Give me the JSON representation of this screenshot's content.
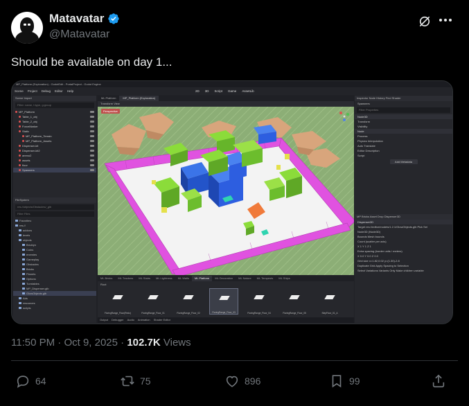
{
  "author": {
    "display_name": "Matavatar",
    "handle": "@Matavatar",
    "verified": true
  },
  "tweet": {
    "text": "Should be available on day 1...",
    "time": "11:50 PM",
    "separator": "·",
    "date": "Oct 9, 2025",
    "views_count": "102.7K",
    "views_label": "Views"
  },
  "actions": {
    "replies": "64",
    "reposts": "75",
    "likes": "896",
    "bookmarks": "99"
  },
  "editor": {
    "title": "MP_Platform (Exploration) - GodotEdit - PortalProject - Godot Engine",
    "menu": [
      "Scene",
      "Project",
      "Debug",
      "Editor",
      "Help"
    ],
    "modes": [
      "2D",
      "3D",
      "Script",
      "Game",
      "AssetLib"
    ],
    "scene_panel_tabs": "Scene   Import",
    "filter_placeholder": "Filter: name, t:type, g:group",
    "scene_tree": [
      {
        "label": "MP_Platform",
        "selected": false
      },
      {
        "label": "Table_1_obj",
        "selected": false
      },
      {
        "label": "Table_2_obj",
        "selected": false
      },
      {
        "label": "ForceMarker",
        "selected": false
      },
      {
        "label": "Static",
        "selected": false
      },
      {
        "label": "MP_Platform_Terrain",
        "selected": false
      },
      {
        "label": "MP_Platform_Assets",
        "selected": false
      },
      {
        "label": "Dispenser-kit",
        "selected": false
      },
      {
        "label": "Dispenser-kit2",
        "selected": false
      },
      {
        "label": "ammo2",
        "selected": false
      },
      {
        "label": "assets",
        "selected": false
      },
      {
        "label": "floor",
        "selected": false
      },
      {
        "label": "Spawners",
        "selected": true
      }
    ],
    "filesystem_header": "FileSystem",
    "filesystem_path": "res://objects/Obstacles/_glb",
    "filter_files": "Filter Files",
    "filesystem": [
      {
        "label": "Favorites:",
        "selected": false
      },
      {
        "label": "res://",
        "selected": false
      },
      {
        "label": "addons",
        "selected": false
      },
      {
        "label": "levels",
        "selected": false
      },
      {
        "label": "objects",
        "selected": false
      },
      {
        "label": "Bricklyn",
        "selected": false
      },
      {
        "label": "Coins",
        "selected": false
      },
      {
        "label": "enemies",
        "selected": false
      },
      {
        "label": "Gameplay",
        "selected": false
      },
      {
        "label": "Obstacles",
        "selected": false
      },
      {
        "label": "Bricks",
        "selected": false
      },
      {
        "label": "Planets",
        "selected": false
      },
      {
        "label": "Options",
        "selected": false
      },
      {
        "label": "Turntables",
        "selected": false
      },
      {
        "label": "MP_Dispenser.glb",
        "selected": false
      },
      {
        "label": "GlowObjects.glb",
        "selected": true
      },
      {
        "label": "Ads",
        "selected": false
      },
      {
        "label": "resources",
        "selected": false
      },
      {
        "label": "scripts",
        "selected": false
      }
    ],
    "scene_tabs": [
      {
        "label": "ML Platform",
        "active": false
      },
      {
        "label": "MP_Platform (Exploration)",
        "active": true
      }
    ],
    "viewport_toolbar": "Transform   View",
    "viewport_label": "Perspective",
    "bottom_tabs": [
      {
        "label": "ML Bricks",
        "active": false
      },
      {
        "label": "ML Trackers",
        "active": false
      },
      {
        "label": "ML Stairs",
        "active": false
      },
      {
        "label": "ML Lightness",
        "active": false
      },
      {
        "label": "ML Walls",
        "active": false
      },
      {
        "label": "ML Platform",
        "active": true
      },
      {
        "label": "ML Decoration",
        "active": false
      },
      {
        "label": "ML Nature",
        "active": false
      },
      {
        "label": "ML Tempests",
        "active": false
      },
      {
        "label": "ML Ships",
        "active": false
      }
    ],
    "bottom_root": "Root",
    "assets": [
      {
        "label": "FloringRange_Floor(Redo)",
        "selected": false
      },
      {
        "label": "FloringRange_Floor_01",
        "selected": false
      },
      {
        "label": "FloringRange_Floor_02",
        "selected": false
      },
      {
        "label": "FloringRange_Floor_03",
        "selected": true
      },
      {
        "label": "FloringRange_Floor_04",
        "selected": false
      },
      {
        "label": "FloringRange_Floor_05",
        "selected": false
      },
      {
        "label": "StepFloor_01_A",
        "selected": false
      },
      {
        "label": "StepFloor_01_B",
        "selected": false
      }
    ],
    "status": [
      "Output",
      "Debugger",
      "Audio",
      "Animation",
      "Shader Editor"
    ],
    "inspector_tabs": "Inspector   Node   History   Find   Shader",
    "inspector_node": "Spawners",
    "inspector_filter": "Filter Properties",
    "inspector_rows": [
      {
        "label": "Node3D",
        "section": true
      },
      {
        "label": "Transform",
        "section": false
      },
      {
        "label": "Visibility",
        "section": false
      },
      {
        "label": "Node",
        "section": true
      },
      {
        "label": "Process",
        "section": false
      },
      {
        "label": "Physics Interpolation",
        "section": false
      },
      {
        "label": "Auto Translate",
        "section": false
      },
      {
        "label": "Editor Description",
        "section": false
      },
      {
        "label": "Script",
        "section": false
      }
    ],
    "add_metadata": "Add Metadata",
    "dispenser_tabs": "MP Bricks   Asset Drop   Dispenser3D",
    "dispenser_label": "Dispenser3D",
    "dispenser_rows": [
      "Target  res://editor/models/1.2.1/GlowObjects.glb  Pick Sel",
      "Node3D (Node3D)",
      "Bounds  Mesh bounds",
      "Count (scatter per axis)",
      "X 1     Y 1     Z 1",
      "Extra spacing (border units / meters)",
      "X 0.0   Y 0.0   Z 0.0",
      "Grid size  x=1.82,0.02  y=(1.30)-2.8",
      "Duplicate Grid  Apply Spacing to Selection",
      "Select Variations  Variants Only  Make children variable"
    ]
  }
}
